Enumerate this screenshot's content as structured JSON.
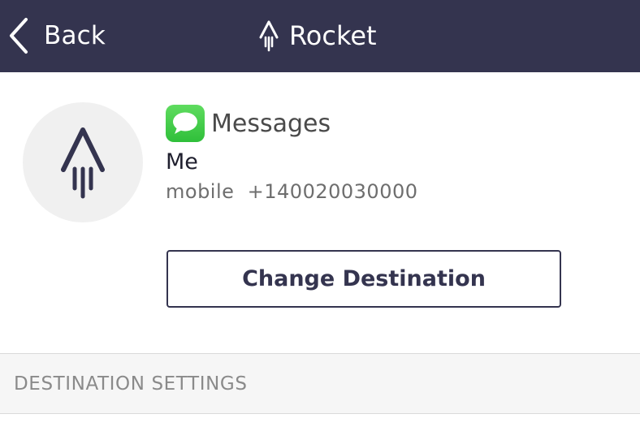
{
  "navbar": {
    "back_label": "Back",
    "title": "Rocket",
    "back_icon": "chevron-left-icon",
    "title_icon": "rocket-icon",
    "background": "#34344f"
  },
  "destination": {
    "avatar_icon": "rocket-icon",
    "app_icon": "messages-icon",
    "app_name": "Messages",
    "contact_name": "Me",
    "contact_phone": "mobile  +140020030000"
  },
  "actions": {
    "change_destination_label": "Change Destination"
  },
  "settings": {
    "section_title": "DESTINATION SETTINGS"
  }
}
